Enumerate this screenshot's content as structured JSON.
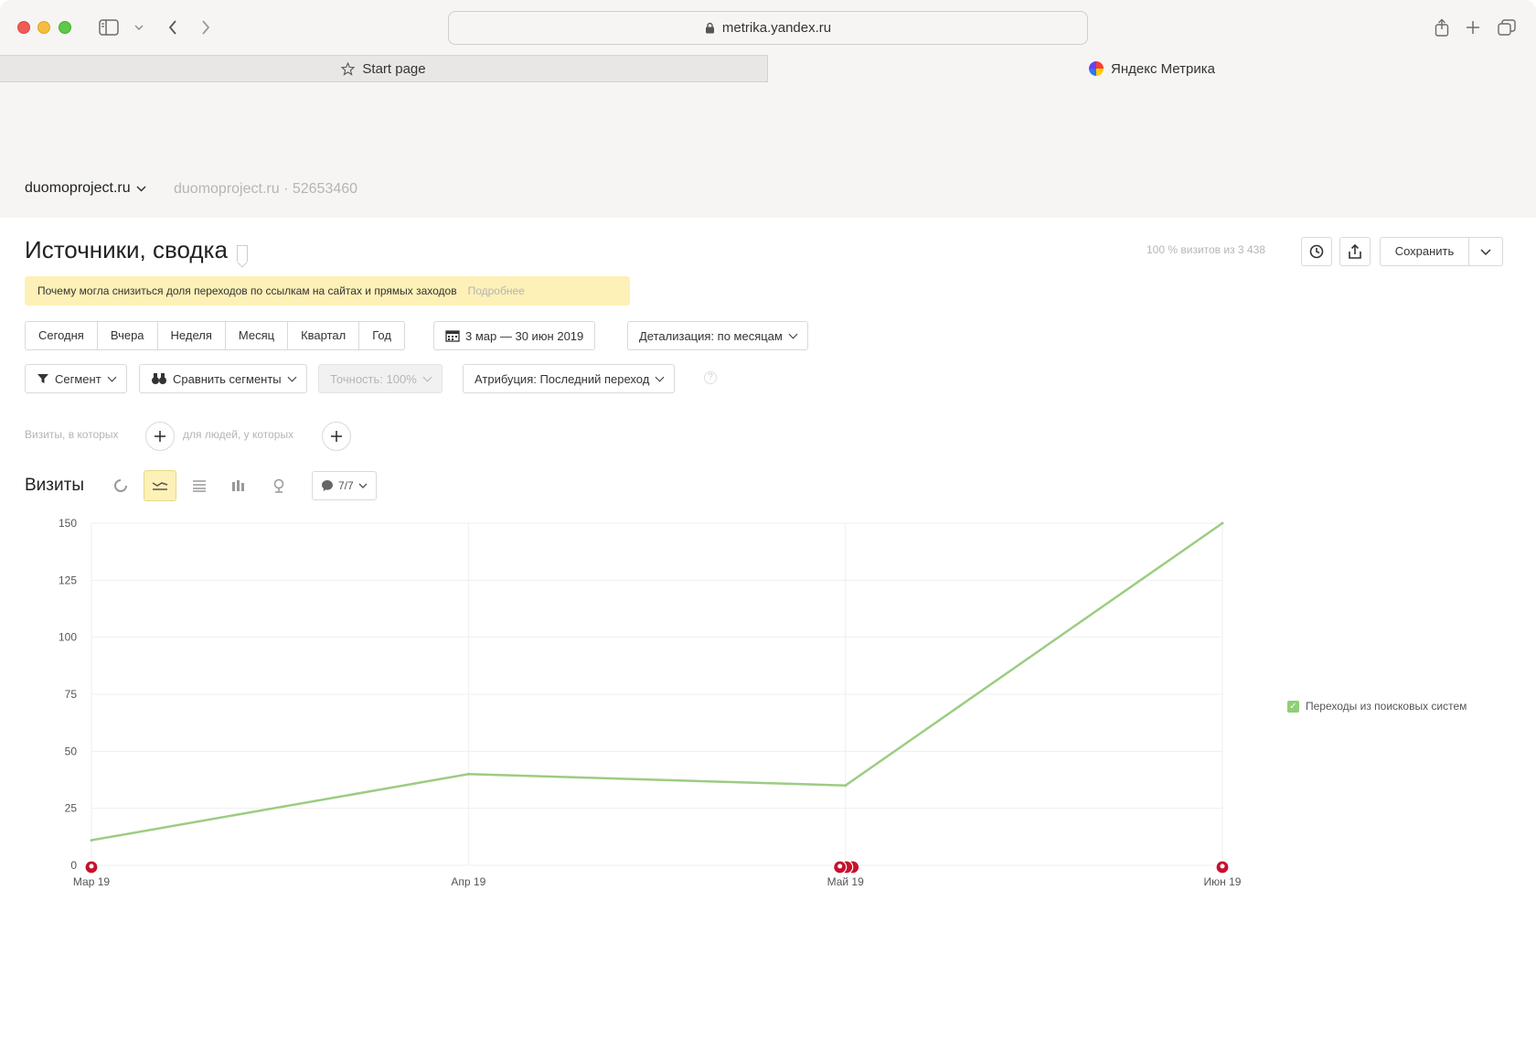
{
  "browser": {
    "url": "metrika.yandex.ru",
    "tabs": [
      {
        "label": "Start page"
      },
      {
        "label": "Яндекс Метрика"
      }
    ]
  },
  "header": {
    "site_name": "duomoproject.ru",
    "site_counter": "duomoproject.ru · 52653460"
  },
  "report": {
    "title": "Источники, сводка",
    "visits_share": "100 % визитов из 3 438",
    "save_label": "Сохранить",
    "notice_text": "Почему могла снизиться доля переходов по ссылкам на сайтах и прямых заходов",
    "notice_more": "Подробнее"
  },
  "period": {
    "presets": [
      "Сегодня",
      "Вчера",
      "Неделя",
      "Месяц",
      "Квартал",
      "Год"
    ],
    "date_range": "3 мар — 30 июн 2019",
    "detail": "Детализация: по месяцам"
  },
  "filters": {
    "segment": "Сегмент",
    "compare": "Сравнить сегменты",
    "accuracy": "Точность: 100%",
    "attribution": "Атрибуция: Последний переход",
    "help": "?"
  },
  "conditions": {
    "visits_label": "Визиты, в которых",
    "people_label": "для людей, у которых"
  },
  "chart_section": {
    "title": "Визиты",
    "notes_count": "7/7"
  },
  "colors": {
    "line": "#9ccc82",
    "marker": "#c8102e",
    "highlight": "#fdf1b8"
  },
  "chart_data": {
    "type": "line",
    "x": [
      "Мар 19",
      "Апр 19",
      "Май 19",
      "Июн 19"
    ],
    "yticks": [
      0,
      25,
      50,
      75,
      100,
      125,
      150
    ],
    "ylim": [
      0,
      150
    ],
    "series": [
      {
        "name": "Переходы из поисковых систем",
        "values": [
          11,
          40,
          35,
          150
        ]
      }
    ],
    "notes_markers": [
      {
        "x": "Мар 19",
        "count": 1
      },
      {
        "x": "Май 19",
        "count": 3
      },
      {
        "x": "Июн 19",
        "count": 1
      }
    ],
    "legend": "right",
    "grid": true
  }
}
